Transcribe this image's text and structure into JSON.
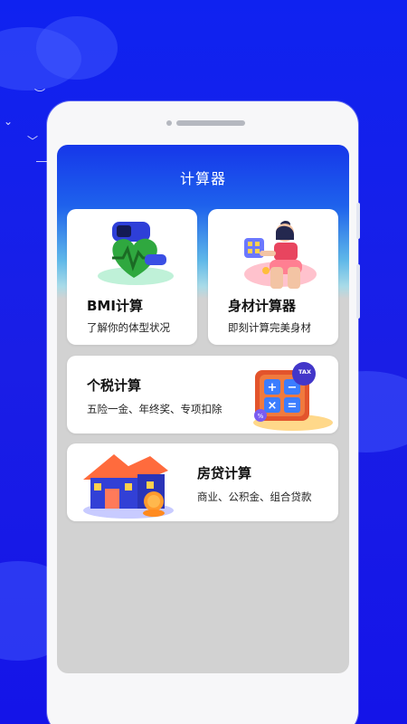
{
  "app": {
    "title": "计算器"
  },
  "cards": {
    "bmi": {
      "title": "BMI计算",
      "subtitle": "了解你的体型状况",
      "icon": "heart-watch-icon"
    },
    "body": {
      "title": "身材计算器",
      "subtitle": "即刻计算完美身材",
      "icon": "woman-calculator-icon"
    },
    "tax": {
      "title": "个税计算",
      "subtitle": "五险一金、年终奖、专项扣除",
      "icon": "tax-calculator-icon",
      "badge": "TAX"
    },
    "mortgage": {
      "title": "房贷计算",
      "subtitle": "商业、公积金、组合贷款",
      "icon": "house-coins-icon"
    }
  },
  "colors": {
    "background": "#1220e0",
    "header_top": "#1637ea",
    "header_bottom": "#a9dbe8",
    "card": "#ffffff",
    "screen_bg": "#d2d2d2"
  }
}
